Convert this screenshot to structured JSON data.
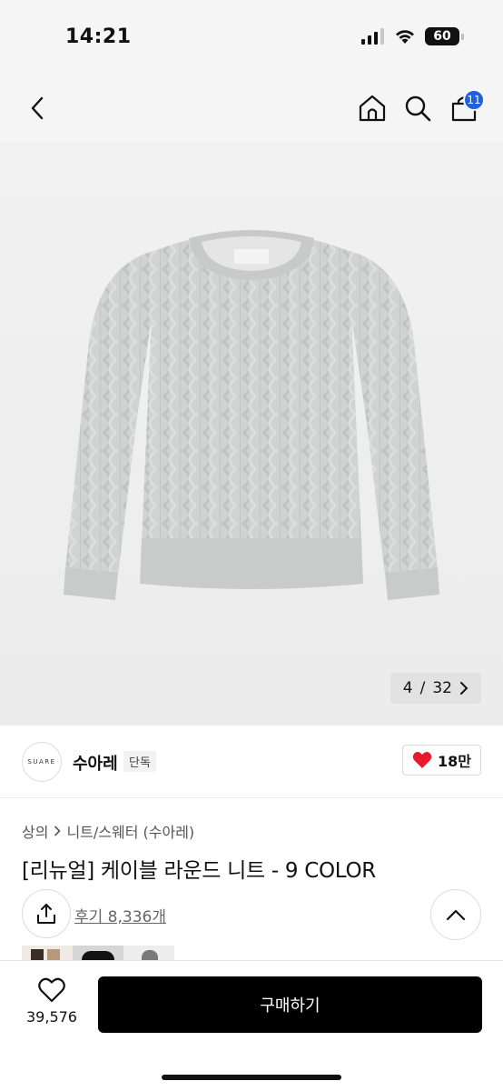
{
  "status": {
    "time": "14:21",
    "battery": "60"
  },
  "nav": {
    "cart_count": "11"
  },
  "gallery": {
    "current": "4",
    "separator": "/",
    "total": "32"
  },
  "brand": {
    "logo_text": "SUARE",
    "name": "수아레",
    "tag": "단독",
    "likes": "18만"
  },
  "breadcrumb": {
    "level1": "상의",
    "level2": "니트/스웨터 (수아레)"
  },
  "product": {
    "title": "[리뉴얼] 케이블 라운드 니트 - 9 COLOR",
    "reviews": "후기 8,336개"
  },
  "bottom": {
    "wish_count": "39,576",
    "buy_label": "구매하기"
  },
  "colors": {
    "accent": "#1f5fe0",
    "heart": "#e8192c",
    "sweater": "#cfd1d0"
  }
}
